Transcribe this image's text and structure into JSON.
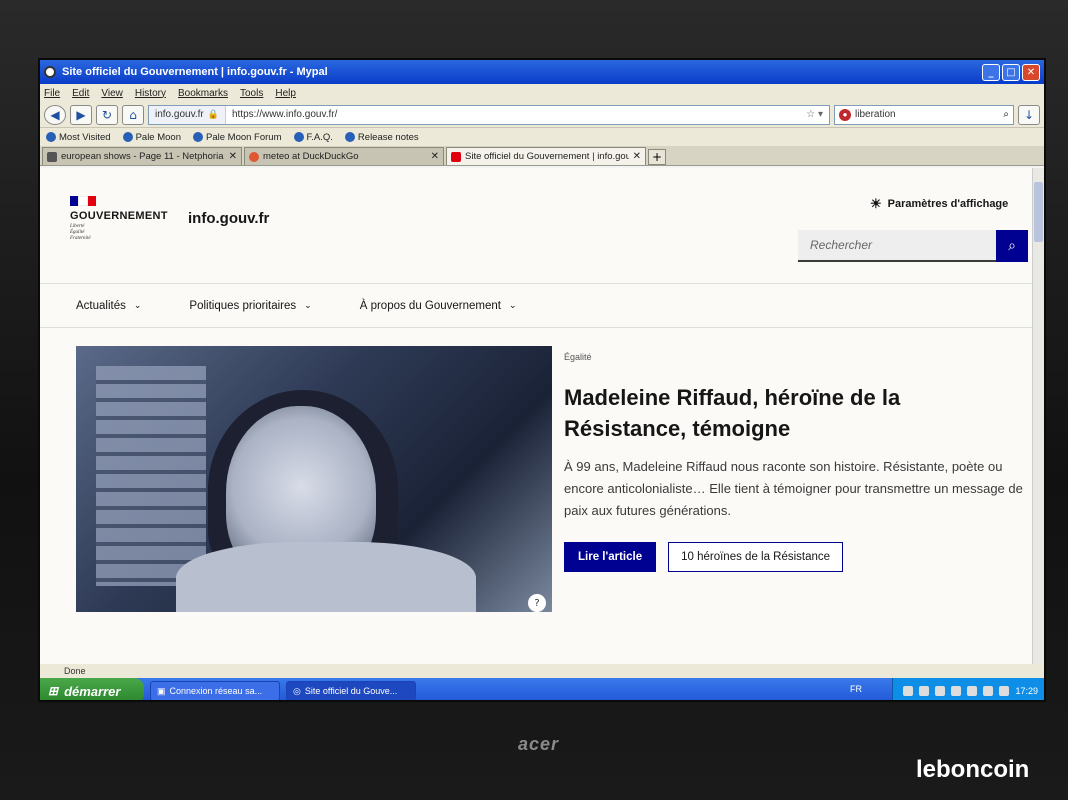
{
  "window": {
    "title": "Site officiel du Gouvernement | info.gouv.fr - Mypal"
  },
  "menu": [
    "File",
    "Edit",
    "View",
    "History",
    "Bookmarks",
    "Tools",
    "Help"
  ],
  "navbar": {
    "site_identity": "info.gouv.fr",
    "url": "https://www.info.gouv.fr/",
    "search_query": "liberation"
  },
  "bookmarks": [
    "Most Visited",
    "Pale Moon",
    "Pale Moon Forum",
    "F.A.Q.",
    "Release notes"
  ],
  "tabs": [
    {
      "label": "european shows - Page 11 - Netphoria M...",
      "active": false
    },
    {
      "label": "meteo at DuckDuckGo",
      "active": false
    },
    {
      "label": "Site officiel du Gouvernement | info.gouv...",
      "active": true
    }
  ],
  "page": {
    "logo_text": "GOUVERNEMENT",
    "logo_motto": [
      "Liberté",
      "Égalité",
      "Fraternité"
    ],
    "site_name": "info.gouv.fr",
    "display_settings": "Paramètres d'affichage",
    "search_placeholder": "Rechercher",
    "nav": [
      "Actualités",
      "Politiques prioritaires",
      "À propos du Gouvernement"
    ],
    "hero": {
      "tag": "Égalité",
      "title": "Madeleine Riffaud, héroïne de la Résistance, témoigne",
      "lede": "À 99 ans, Madeleine Riffaud nous raconte son histoire. Résistante, poète ou encore anticolonialiste… Elle tient à témoigner pour transmettre un message de paix aux futures générations.",
      "primary_cta": "Lire l'article",
      "secondary_cta": "10 héroïnes de la Résistance"
    }
  },
  "status": "Done",
  "taskbar": {
    "start": "démarrer",
    "tasks": [
      "Connexion réseau sa...",
      "Site officiel du Gouve..."
    ],
    "lang": "FR",
    "clock": "17:29"
  },
  "hardware": {
    "brand": "acer",
    "watermark": "leboncoin"
  },
  "colors": {
    "accent": "#000091",
    "flag_blue": "#000091",
    "flag_white": "#ffffff",
    "flag_red": "#e1000f"
  }
}
